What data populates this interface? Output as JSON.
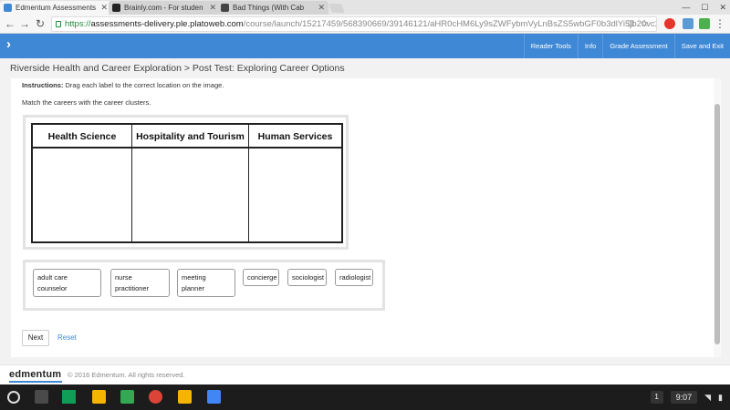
{
  "browser": {
    "tabs": [
      {
        "label": "Edmentum Assessments",
        "active": true
      },
      {
        "label": "Brainly.com - For studen",
        "active": false
      },
      {
        "label": "Bad Things (With Cab",
        "active": false
      }
    ],
    "url": {
      "scheme": "https://",
      "host": "assessments-delivery.ple.platoweb.com",
      "path": "/course/launch/15217459/568390669/39146121/aHR0cHM6Ly9sZWFybmVyLnBsZS5wbGF0b3dlYi5jb20vc2Vjb25kYXJ5L"
    }
  },
  "header": {
    "menu": [
      "Reader Tools",
      "Info",
      "Grade Assessment",
      "Save and Exit"
    ]
  },
  "breadcrumb": "Riverside Health and Career Exploration > Post Test: Exploring Career Options",
  "question": {
    "instructions_label": "Instructions:",
    "instructions_text": "Drag each label to the correct location on the image.",
    "prompt": "Match the careers with the career clusters.",
    "columns": [
      "Health Science",
      "Hospitality and Tourism",
      "Human Services"
    ],
    "labels": [
      {
        "line1": "adult care",
        "line2": "counselor"
      },
      {
        "line1": "nurse",
        "line2": "practitioner"
      },
      {
        "line1": "meeting",
        "line2": "planner"
      },
      {
        "line1": "concierge",
        "line2": ""
      },
      {
        "line1": "sociologist",
        "line2": ""
      },
      {
        "line1": "radiologist",
        "line2": ""
      }
    ]
  },
  "actions": {
    "next": "Next",
    "reset": "Reset"
  },
  "footer": {
    "logo": "edmentum",
    "copyright": "© 2016 Edmentum. All rights reserved."
  },
  "shelf": {
    "notification_count": "1",
    "time": "9:07"
  },
  "colors": {
    "accent": "#3f88d6",
    "link": "#3f88d6",
    "secure": "#1f8a3b"
  }
}
